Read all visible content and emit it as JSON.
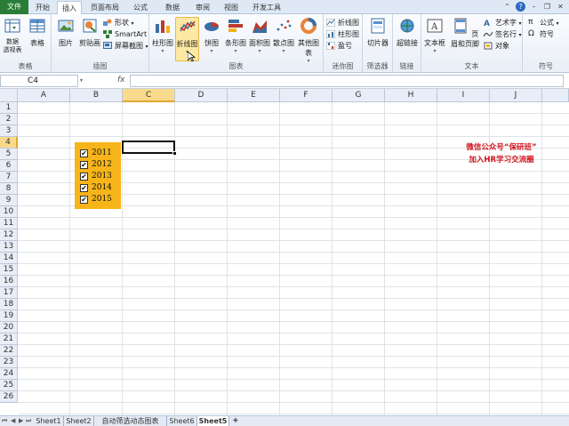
{
  "menu": {
    "file": "文件",
    "tabs": [
      "开始",
      "插入",
      "页面布局",
      "公式",
      "数据",
      "审阅",
      "视图",
      "开发工具"
    ],
    "active_tab": "插入"
  },
  "ribbon": {
    "tables": {
      "pivot": "数据\n透视表",
      "table": "表格",
      "label": "表格"
    },
    "illustrations": {
      "picture": "图片",
      "clipart": "剪贴画",
      "shapes": "形状",
      "smartart": "SmartArt",
      "screenshot": "屏幕截图",
      "label": "插图"
    },
    "charts": {
      "column": "柱形图",
      "line": "折线图",
      "pie": "饼图",
      "bar": "条形图",
      "area": "面积图",
      "scatter": "散点图",
      "other": "其他图表",
      "label": "图表"
    },
    "sparklines": {
      "line": "折线图",
      "column": "柱形图",
      "winloss": "盈亏",
      "label": "迷你图"
    },
    "filter": {
      "slicer": "切片器",
      "label": "筛选器"
    },
    "links": {
      "hyperlink": "超链接",
      "label": "链接"
    },
    "text": {
      "textbox": "文本框",
      "header_footer": "页眉和页脚",
      "wordart": "艺术字",
      "signature": "签名行",
      "object": "对象",
      "label": "文本"
    },
    "symbols": {
      "equation": "公式",
      "symbol": "符号",
      "label": "符号"
    }
  },
  "formula_bar": {
    "name_box": "C4",
    "fx": "fx",
    "content": ""
  },
  "columns": [
    "A",
    "B",
    "C",
    "D",
    "E",
    "F",
    "G",
    "H",
    "I",
    "J"
  ],
  "rows": [
    "1",
    "2",
    "3",
    "4",
    "5",
    "6",
    "7",
    "8",
    "9",
    "10",
    "11",
    "12",
    "13",
    "14",
    "15",
    "16",
    "17",
    "18",
    "19",
    "20",
    "21",
    "22",
    "23",
    "24",
    "25",
    "26"
  ],
  "active_cell": "C4",
  "checkboxes": [
    {
      "label": "2011",
      "checked": true
    },
    {
      "label": "2012",
      "checked": true
    },
    {
      "label": "2013",
      "checked": true
    },
    {
      "label": "2014",
      "checked": true
    },
    {
      "label": "2015",
      "checked": true
    }
  ],
  "promo": {
    "line1": "微信公众号“保研班”",
    "line2": "加入HR学习交流圈"
  },
  "sheet_tabs": [
    "Sheet1",
    "Sheet2",
    "自动筛选动态图表",
    "Sheet6",
    "Sheet5"
  ],
  "active_sheet": "Sheet5",
  "colors": {
    "file_tab": "#2a7d36",
    "panel": "#f7b519",
    "promo": "#d0141c",
    "selection": "#f9d98b"
  }
}
